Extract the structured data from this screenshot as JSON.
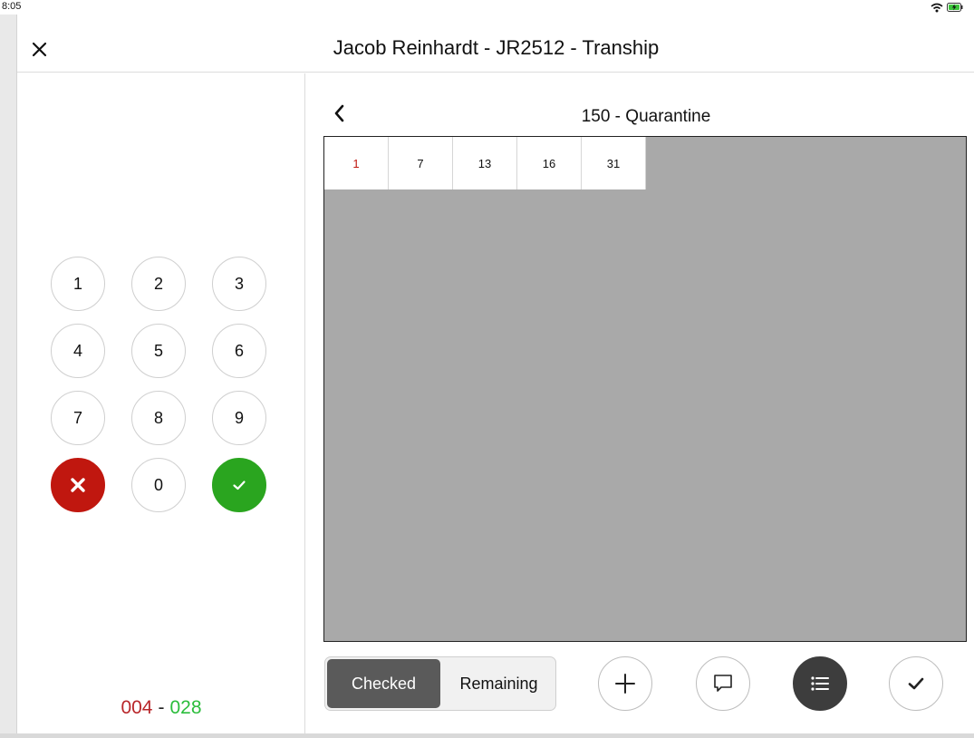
{
  "status_bar": {
    "time": "8:05"
  },
  "header": {
    "title": "Jacob Reinhardt - JR2512 - Tranship"
  },
  "keypad": {
    "keys": [
      "1",
      "2",
      "3",
      "4",
      "5",
      "6",
      "7",
      "8",
      "9",
      "0"
    ]
  },
  "counter": {
    "checked": "004",
    "separator": "-",
    "total": "028"
  },
  "panel": {
    "title": "150 - Quarantine",
    "cells": [
      {
        "label": "1",
        "active": true
      },
      {
        "label": "7",
        "active": false
      },
      {
        "label": "13",
        "active": false
      },
      {
        "label": "16",
        "active": false
      },
      {
        "label": "31",
        "active": false
      }
    ]
  },
  "toolbar": {
    "segment": {
      "checked_label": "Checked",
      "remaining_label": "Remaining",
      "selected": "Checked"
    }
  },
  "colors": {
    "cancel": "#c0170f",
    "confirm": "#2aa51f",
    "checked_count": "#b8262a",
    "total_count": "#2bbd3c",
    "grid_background": "#a9a9a9"
  },
  "icons": {
    "header": "close-icon",
    "back": "chevron-left-icon",
    "cancel_key": "close-icon",
    "confirm_key": "check-icon",
    "add": "plus-icon",
    "comment": "comment-icon",
    "list": "list-icon",
    "done": "check-icon"
  }
}
